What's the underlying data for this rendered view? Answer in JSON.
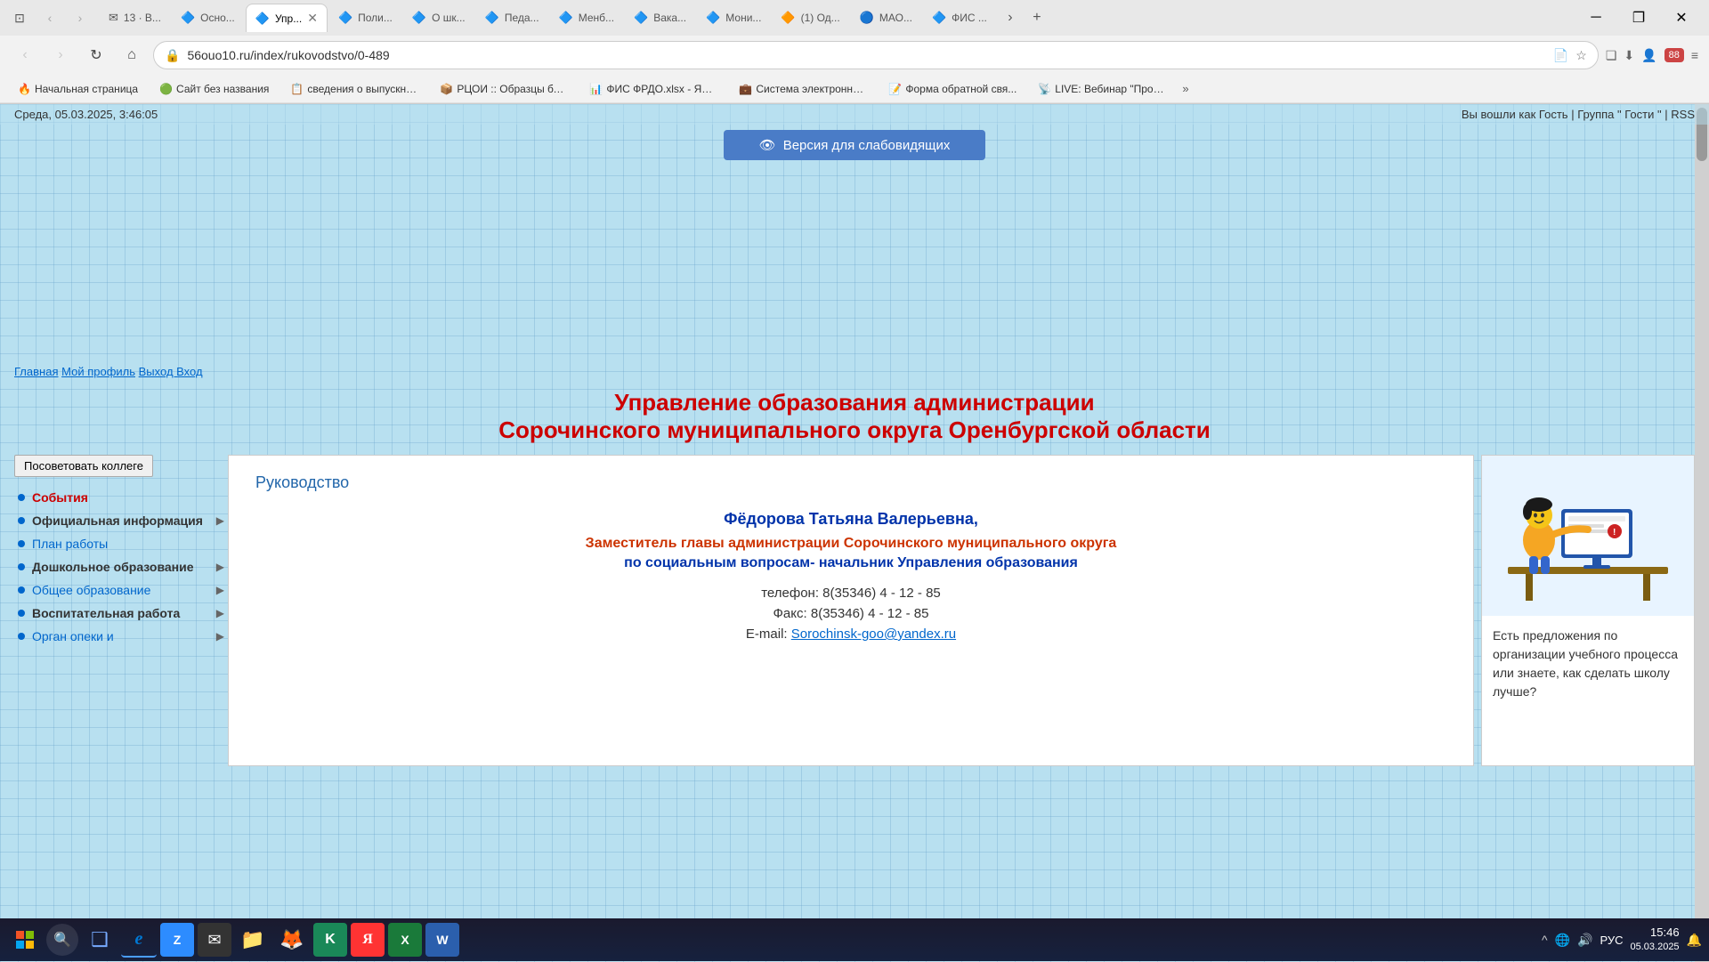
{
  "browser": {
    "tabs": [
      {
        "id": "tab1",
        "favicon": "✉",
        "label": "13 · В...",
        "active": false,
        "color": "#c44"
      },
      {
        "id": "tab2",
        "favicon": "🔷",
        "label": "Осно...",
        "active": false
      },
      {
        "id": "tab3",
        "favicon": "🔷",
        "label": "Упр...",
        "active": true
      },
      {
        "id": "tab4",
        "favicon": "🔷",
        "label": "Поли...",
        "active": false
      },
      {
        "id": "tab5",
        "favicon": "🔷",
        "label": "О шк...",
        "active": false
      },
      {
        "id": "tab6",
        "favicon": "🔷",
        "label": "Педа...",
        "active": false
      },
      {
        "id": "tab7",
        "favicon": "🔷",
        "label": "Менб...",
        "active": false
      },
      {
        "id": "tab8",
        "favicon": "🔷",
        "label": "Вака...",
        "active": false
      },
      {
        "id": "tab9",
        "favicon": "🔷",
        "label": "Мони...",
        "active": false
      },
      {
        "id": "tab10",
        "favicon": "🔶",
        "label": "(1) Од...",
        "active": false
      },
      {
        "id": "tab11",
        "favicon": "🔵",
        "label": "МАО...",
        "active": false
      },
      {
        "id": "tab12",
        "favicon": "🔷",
        "label": "ФИС ...",
        "active": false
      }
    ],
    "address": "56ouo10.ru/index/rukovodstvo/0-489",
    "new_tab_label": "+",
    "more_tabs_label": "⌄"
  },
  "bookmarks": [
    {
      "icon": "🔥",
      "label": "Начальная страница"
    },
    {
      "icon": "🟢",
      "label": "Сайт без названия"
    },
    {
      "icon": "📋",
      "label": "сведения о выпускник..."
    },
    {
      "icon": "📦",
      "label": "РЦОИ :: Образцы бла..."
    },
    {
      "icon": "📊",
      "label": "ФИС ФРДО.xlsx - Янд..."
    },
    {
      "icon": "💼",
      "label": "Система электронног..."
    },
    {
      "icon": "📝",
      "label": "Форма обратной свя..."
    },
    {
      "icon": "📡",
      "label": "LIVE: Вебинар \"Проф..."
    }
  ],
  "page": {
    "datetime": "Среда, 05.03.2025, 3:46:05",
    "user_info": "Вы вошли как",
    "user_link": "Гость",
    "group_label": "Группа",
    "group_link": "Гости",
    "rss_label": "RSS",
    "version_btn": "Версия для слабовидящих",
    "breadcrumbs": [
      {
        "label": "Главная",
        "href": "#"
      },
      {
        "label": "Мой профиль",
        "href": "#"
      },
      {
        "label": "Выход Вход",
        "href": "#"
      }
    ],
    "title_line1": "Управление образования администрации",
    "title_line2": "Сорочинского муниципального округа Оренбургской области",
    "section_title": "Руководство",
    "sidebar": {
      "suggest_btn": "Посоветовать коллеге",
      "items": [
        {
          "label": "События",
          "active": true,
          "has_arrow": false
        },
        {
          "label": "Официальная информация",
          "active": false,
          "has_arrow": true,
          "dark": true
        },
        {
          "label": "План работы",
          "active": false,
          "has_arrow": false
        },
        {
          "label": "Дошкольное образование",
          "active": false,
          "has_arrow": true,
          "dark": true
        },
        {
          "label": "Общее образование",
          "active": false,
          "has_arrow": true
        },
        {
          "label": "Воспитательная работа",
          "active": false,
          "has_arrow": true,
          "dark": true
        },
        {
          "label": "Орган опеки и",
          "active": false,
          "has_arrow": true
        }
      ]
    },
    "person_name": "Фёдорова Татьяна Валерьевна,",
    "person_title": "Заместитель главы администрации Сорочинского муниципального округа",
    "person_role": "по социальным вопросам- начальник Управления образования",
    "phone_label": "телефон:",
    "phone_value": "8(35346) 4 - 12 - 85",
    "fax_label": "Факс:",
    "fax_value": "8(35346) 4 - 12 - 85",
    "email_label": "E-mail:",
    "email_value": "Sorochinsk-goo@yandex.ru",
    "right_panel_text": "Есть предложения по организации учебного процесса или знаете, как сделать школу лучше?"
  },
  "taskbar": {
    "apps": [
      {
        "name": "windows-start",
        "icon": "⊞",
        "label": "Start"
      },
      {
        "name": "search",
        "icon": "🔍",
        "label": "Search"
      },
      {
        "name": "task-view",
        "icon": "❑",
        "label": "Task View"
      },
      {
        "name": "edge",
        "icon": "e",
        "label": "Edge",
        "active": true
      },
      {
        "name": "zoom",
        "icon": "Z",
        "label": "Zoom",
        "bg": "#2d8cff"
      },
      {
        "name": "mail",
        "icon": "✉",
        "label": "Mail",
        "bg": "#c44"
      },
      {
        "name": "files",
        "icon": "📁",
        "label": "Files"
      },
      {
        "name": "firefox",
        "icon": "🦊",
        "label": "Firefox"
      },
      {
        "name": "kaspersky",
        "icon": "K",
        "label": "Kaspersky",
        "bg": "#1a8"
      },
      {
        "name": "yandex",
        "icon": "Я",
        "label": "Yandex",
        "bg": "#f33"
      },
      {
        "name": "excel",
        "icon": "X",
        "label": "Excel",
        "bg": "#1a7a3a"
      },
      {
        "name": "word",
        "icon": "W",
        "label": "Word",
        "bg": "#2b5fad"
      }
    ],
    "tray": {
      "language": "РУС",
      "time": "15:46",
      "date": "05.03.2025"
    }
  }
}
